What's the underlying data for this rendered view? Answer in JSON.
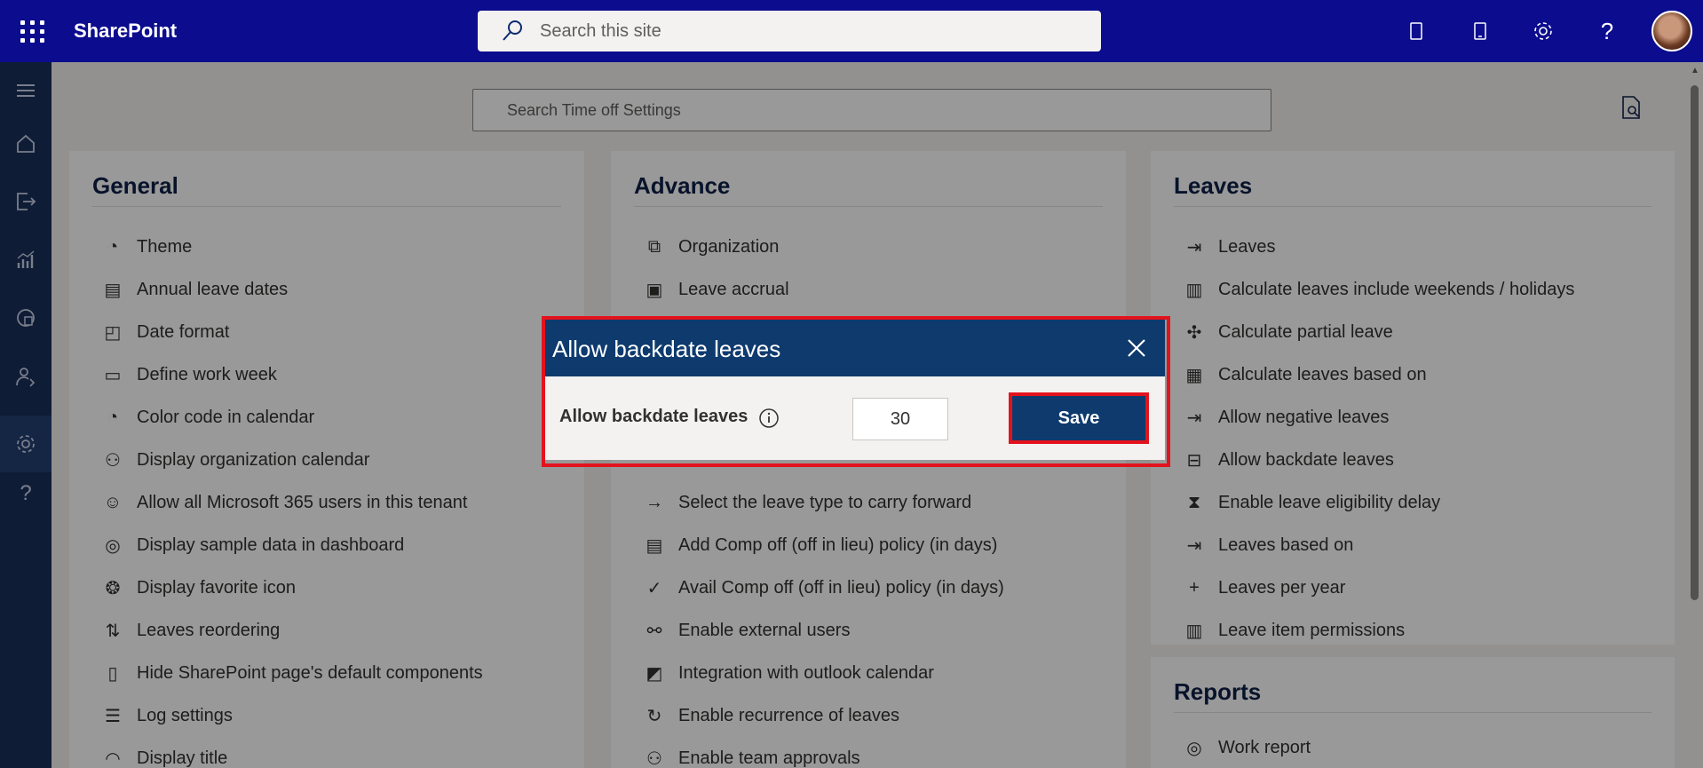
{
  "app": {
    "name": "SharePoint"
  },
  "topbar": {
    "search_placeholder": "Search this site",
    "icons": [
      "waffle-icon",
      "notebook-icon",
      "mobile-icon",
      "gear-icon",
      "help-icon",
      "avatar"
    ]
  },
  "rail": {
    "items": [
      "menu-icon",
      "home-icon",
      "leaves-icon",
      "chart-icon",
      "report-icon",
      "user-settings-icon",
      "gear-icon",
      "help-icon"
    ],
    "active": "gear-icon"
  },
  "settings_search": {
    "placeholder": "Search Time off Settings"
  },
  "general": {
    "title": "General",
    "items": [
      "Theme",
      "Annual leave dates",
      "Date format",
      "Define work week",
      "Color code in calendar",
      "Display organization calendar",
      "Allow all Microsoft 365 users in this tenant",
      "Display sample data in dashboard",
      "Display favorite icon",
      "Leaves reordering",
      "Hide SharePoint page's default components",
      "Log settings",
      "Display title"
    ]
  },
  "advance": {
    "title": "Advance",
    "items": [
      "Organization",
      "Leave accrual",
      "",
      "",
      "",
      "",
      "Select the leave type to carry forward",
      "Add Comp off (off in lieu) policy (in days)",
      "Avail Comp off (off in lieu) policy (in days)",
      "Enable external users",
      "Integration with outlook calendar",
      "Enable recurrence of leaves",
      "Enable team approvals"
    ]
  },
  "leaves": {
    "title": "Leaves",
    "items": [
      "Leaves",
      "Calculate leaves include weekends / holidays",
      "Calculate partial leave",
      "Calculate leaves based on",
      "Allow negative leaves",
      "Allow backdate leaves",
      "Enable leave eligibility delay",
      "Leaves based on",
      "Leaves per year",
      "Leave item permissions"
    ]
  },
  "reports": {
    "title": "Reports",
    "items": [
      "Work report"
    ]
  },
  "dialog": {
    "title": "Allow backdate leaves",
    "field_label": "Allow backdate leaves",
    "field_value": "30",
    "save_label": "Save"
  },
  "colors": {
    "topbar": "#0c0c8f",
    "rail": "#1a2f5a",
    "dialog_header": "#0e3a6e",
    "highlight": "#e3131d"
  }
}
